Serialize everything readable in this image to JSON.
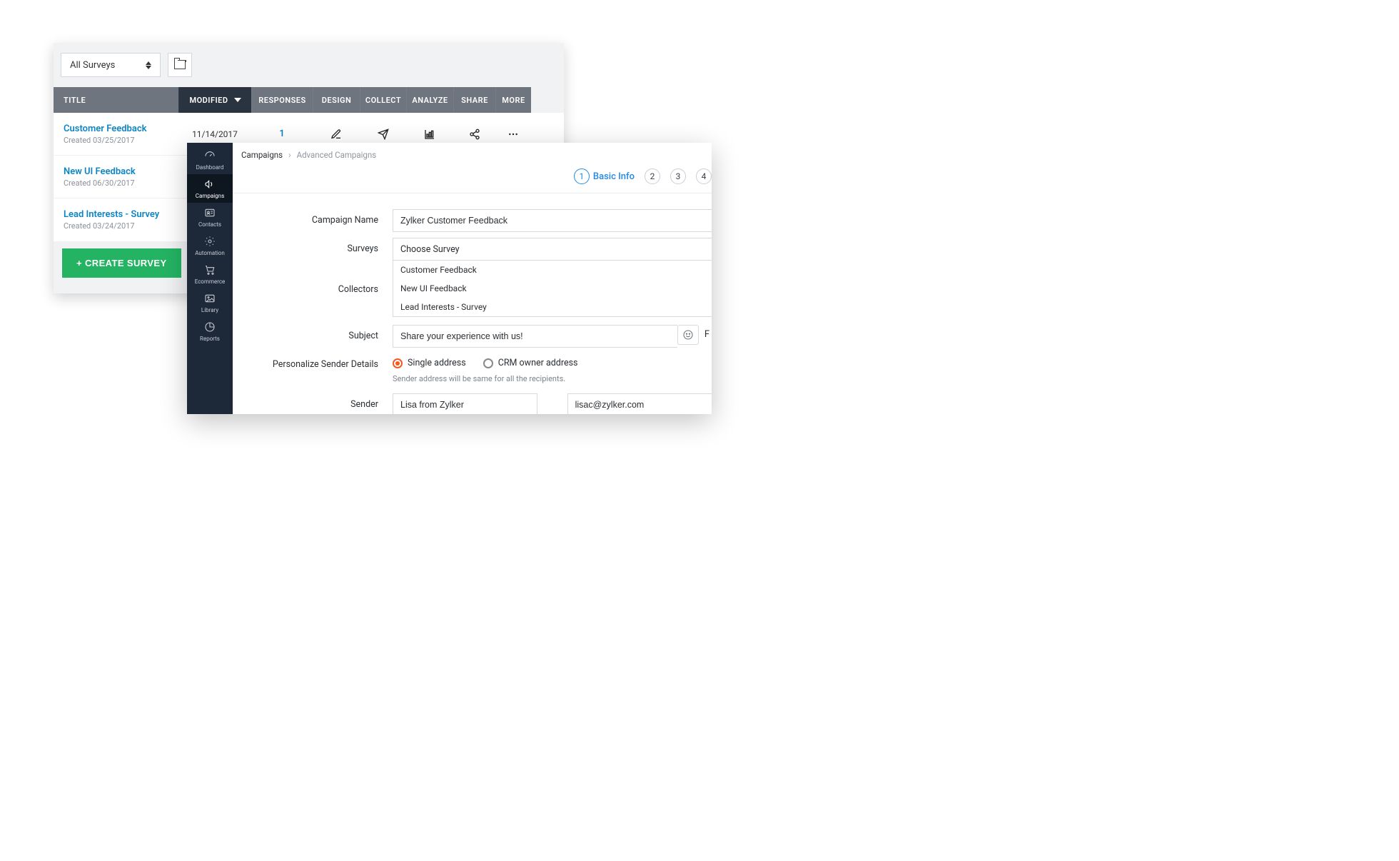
{
  "back": {
    "filter": "All Surveys",
    "columns": {
      "title": "TITLE",
      "modified": "MODIFIED",
      "responses": "RESPONSES",
      "design": "DESIGN",
      "collect": "COLLECT",
      "analyze": "ANALYZE",
      "share": "SHARE",
      "more": "MORE"
    },
    "rows": [
      {
        "name": "Customer Feedback",
        "created": "Created 03/25/2017",
        "modified": "11/14/2017",
        "responses": "1"
      },
      {
        "name": "New UI Feedback",
        "created": "Created 06/30/2017",
        "modified": "",
        "responses": ""
      },
      {
        "name": "Lead Interests - Survey",
        "created": "Created 03/24/2017",
        "modified": "",
        "responses": ""
      }
    ],
    "create_label": "+ CREATE SURVEY"
  },
  "front": {
    "sidebar": [
      {
        "key": "dashboard",
        "label": "Dashboard"
      },
      {
        "key": "campaigns",
        "label": "Campaigns"
      },
      {
        "key": "contacts",
        "label": "Contacts"
      },
      {
        "key": "automation",
        "label": "Automation"
      },
      {
        "key": "ecommerce",
        "label": "Ecommerce"
      },
      {
        "key": "library",
        "label": "Library"
      },
      {
        "key": "reports",
        "label": "Reports"
      }
    ],
    "breadcrumb": {
      "root": "Campaigns",
      "leaf": "Advanced Campaigns"
    },
    "steps": {
      "active_num": "1",
      "active_label": "Basic Info",
      "s2": "2",
      "s3": "3",
      "s4": "4"
    },
    "labels": {
      "campaign_name": "Campaign Name",
      "surveys": "Surveys",
      "collectors": "Collectors",
      "subject": "Subject",
      "personalize": "Personalize Sender Details",
      "sender": "Sender"
    },
    "fields": {
      "campaign_name": "Zylker Customer Feedback",
      "survey_placeholder": "Choose Survey",
      "survey_options": [
        "Customer Feedback",
        "New UI Feedback",
        "Lead Interests - Survey"
      ],
      "subject": "Share your experience with us!",
      "radio_single": "Single address",
      "radio_crm": "CRM owner address",
      "helper": "Sender address will be same for all the recipients.",
      "sender_name": "Lisa from Zylker",
      "sender_email": "lisac@zylker.com"
    },
    "corner_letter": "F"
  }
}
